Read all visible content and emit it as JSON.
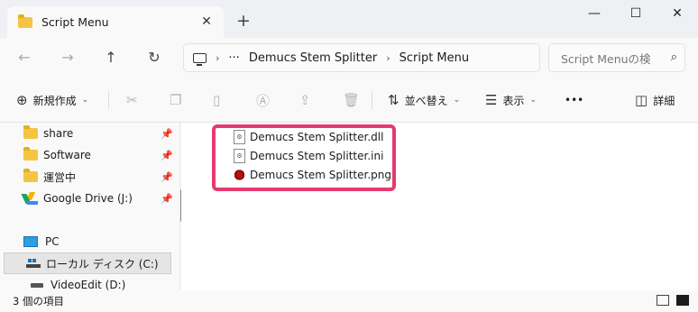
{
  "window": {
    "tab_title": "Script Menu",
    "close_tab": "✕",
    "new_tab": "+",
    "minimize": "—",
    "maximize": "☐",
    "close": "✕"
  },
  "navigation": {
    "back": "←",
    "forward": "→",
    "up": "↑",
    "refresh": "↻",
    "breadcrumb_more": "···",
    "breadcrumbs": [
      "Demucs Stem Splitter",
      "Script Menu"
    ],
    "search_placeholder": "Script Menuの検"
  },
  "toolbar": {
    "new_label": "新規作成",
    "sort_label": "並べ替え",
    "view_label": "表示",
    "more": "•••",
    "details_label": "詳細"
  },
  "sidebar": {
    "quick_access": [
      {
        "label": "share",
        "pinned": true
      },
      {
        "label": "Software",
        "pinned": true
      },
      {
        "label": "運営中",
        "pinned": true
      }
    ],
    "google_drive": "Google Drive (J:)",
    "pc": "PC",
    "drive_c": "ローカル ディスク (C:)",
    "drive_d": "VideoEdit (D:)"
  },
  "files": [
    {
      "name": "Demucs Stem Splitter.dll",
      "type": "dll"
    },
    {
      "name": "Demucs Stem Splitter.ini",
      "type": "ini"
    },
    {
      "name": "Demucs Stem Splitter.png",
      "type": "png"
    }
  ],
  "status": {
    "item_count": "3 個の項目"
  },
  "colors": {
    "highlight": "#e6396e",
    "folder": "#f4c542"
  }
}
